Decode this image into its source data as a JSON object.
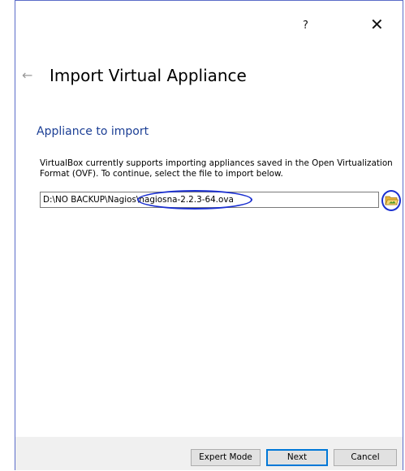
{
  "titlebar": {
    "help_label": "?",
    "close_label": "✕"
  },
  "page": {
    "back_icon": "back-arrow-icon",
    "back_glyph": "←",
    "title": "Import Virtual Appliance"
  },
  "section": {
    "header": "Appliance to import",
    "description": "VirtualBox currently supports importing appliances saved in the Open Virtualization Format (OVF). To continue, select the file to import below."
  },
  "file_input": {
    "value": "D:\\NO BACKUP\\Nagios\\nagiosna-2.2.3-64.ova",
    "browse_icon": "folder-open-icon"
  },
  "annotations": {
    "color": "#1a2fd0"
  },
  "buttons": {
    "expert_mode": "Expert Mode",
    "next": "Next",
    "cancel": "Cancel"
  }
}
